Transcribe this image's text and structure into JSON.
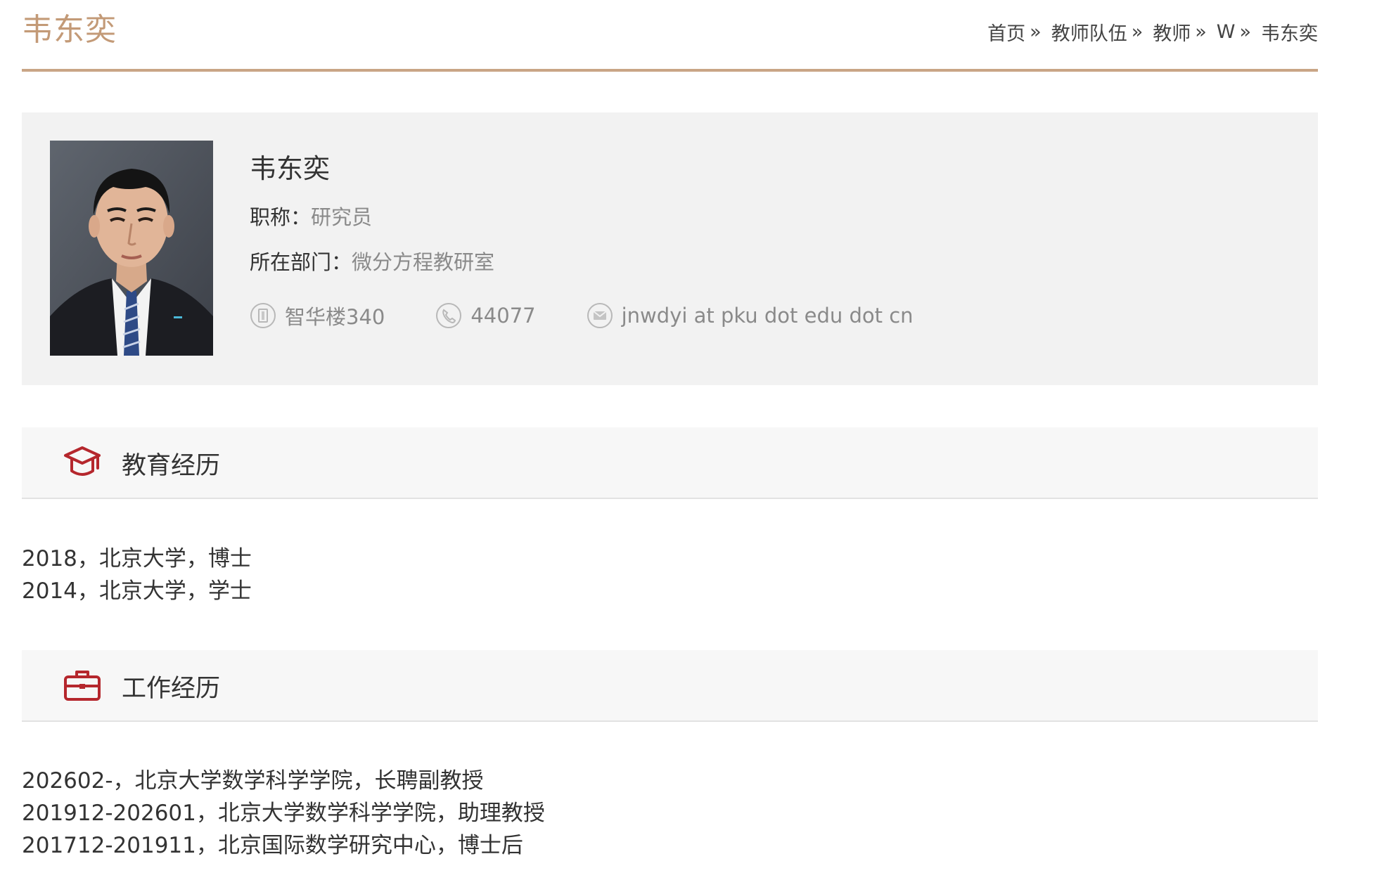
{
  "header": {
    "title": "韦东奕",
    "breadcrumb": [
      {
        "label": "首页",
        "sep": "»"
      },
      {
        "label": "教师队伍",
        "sep": "»"
      },
      {
        "label": "教师",
        "sep": "»"
      },
      {
        "label": "W",
        "sep": "»"
      },
      {
        "label": "韦东奕",
        "sep": ""
      }
    ]
  },
  "profile": {
    "name": "韦东奕",
    "title_label": "职称：",
    "title_value": "研究员",
    "dept_label": "所在部门：",
    "dept_value": "微分方程教研室",
    "office": "智华楼340",
    "phone": "44077",
    "email": "jnwdyi at pku dot edu dot cn",
    "icons": {
      "office": "building-icon",
      "phone": "phone-icon",
      "email": "email-icon",
      "photo": "profile-photo"
    }
  },
  "education": {
    "title": "教育经历",
    "icon": "graduation-cap-icon",
    "items": [
      "2018，北京大学，博士",
      "2014，北京大学，学士"
    ]
  },
  "work": {
    "title": "工作经历",
    "icon": "briefcase-icon",
    "items": [
      "202602-，北京大学数学科学学院，长聘副教授",
      "201912-202601，北京大学数学科学学院，助理教授",
      "201712-201911，北京国际数学研究中心，博士后"
    ]
  },
  "colors": {
    "accent": "#c39a77",
    "rule": "#c9a586",
    "icon_red": "#b5272d",
    "card_bg": "#f2f2f2",
    "muted": "#8a8a8a"
  }
}
